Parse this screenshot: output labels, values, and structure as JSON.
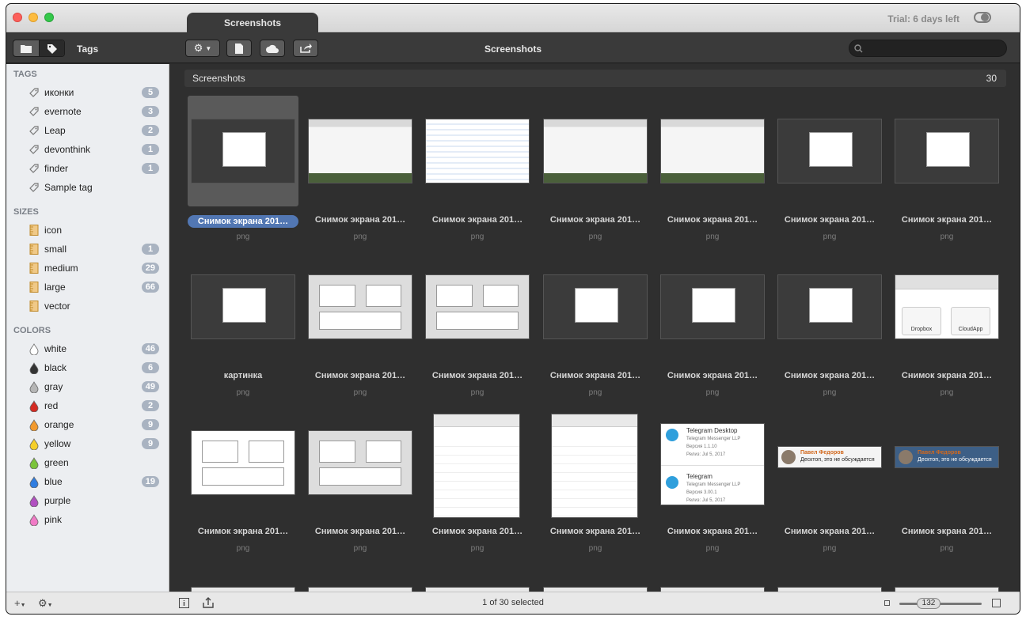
{
  "window": {
    "tab_title": "Screenshots",
    "trial": "Trial: 6 days left"
  },
  "toolbar": {
    "tags_label": "Tags",
    "title": "Screenshots",
    "search_placeholder": ""
  },
  "sidebar": {
    "tags_header": "TAGS",
    "tags": [
      {
        "label": "иконки",
        "count": "5"
      },
      {
        "label": "evernote",
        "count": "3"
      },
      {
        "label": "Leap",
        "count": "2"
      },
      {
        "label": "devonthink",
        "count": "1"
      },
      {
        "label": "finder",
        "count": "1"
      },
      {
        "label": "Sample tag",
        "count": ""
      }
    ],
    "sizes_header": "SIZES",
    "sizes": [
      {
        "label": "icon",
        "count": ""
      },
      {
        "label": "small",
        "count": "1"
      },
      {
        "label": "medium",
        "count": "29"
      },
      {
        "label": "large",
        "count": "66"
      },
      {
        "label": "vector",
        "count": ""
      }
    ],
    "colors_header": "COLORS",
    "colors": [
      {
        "label": "white",
        "count": "46",
        "hex": "#ffffff"
      },
      {
        "label": "black",
        "count": "6",
        "hex": "#333333"
      },
      {
        "label": "gray",
        "count": "49",
        "hex": "#b5b5b5"
      },
      {
        "label": "red",
        "count": "2",
        "hex": "#d42a22"
      },
      {
        "label": "orange",
        "count": "9",
        "hex": "#f29a2e"
      },
      {
        "label": "yellow",
        "count": "9",
        "hex": "#f5cf2a"
      },
      {
        "label": "green",
        "count": "",
        "hex": "#7bc43a"
      },
      {
        "label": "blue",
        "count": "19",
        "hex": "#2f7de0"
      },
      {
        "label": "purple",
        "count": "",
        "hex": "#b04fc0"
      },
      {
        "label": "pink",
        "count": "",
        "hex": "#f07ac6"
      }
    ]
  },
  "collection": {
    "title": "Screenshots",
    "count": "30"
  },
  "items": [
    {
      "caption": "Снимок экрана 201…",
      "ext": "png"
    },
    {
      "caption": "Снимок экрана 201…",
      "ext": "png"
    },
    {
      "caption": "Снимок экрана 201…",
      "ext": "png"
    },
    {
      "caption": "Снимок экрана 201…",
      "ext": "png"
    },
    {
      "caption": "Снимок экрана 201…",
      "ext": "png"
    },
    {
      "caption": "Снимок экрана 201…",
      "ext": "png"
    },
    {
      "caption": "Снимок экрана 201…",
      "ext": "png"
    },
    {
      "caption": "картинка",
      "ext": "png"
    },
    {
      "caption": "Снимок экрана 201…",
      "ext": "png"
    },
    {
      "caption": "Снимок экрана 201…",
      "ext": "png"
    },
    {
      "caption": "Снимок экрана 201…",
      "ext": "png"
    },
    {
      "caption": "Снимок экрана 201…",
      "ext": "png"
    },
    {
      "caption": "Снимок экрана 201…",
      "ext": "png"
    },
    {
      "caption": "Снимок экрана 201…",
      "ext": "png"
    },
    {
      "caption": "Снимок экрана 201…",
      "ext": "png"
    },
    {
      "caption": "Снимок экрана 201…",
      "ext": "png"
    },
    {
      "caption": "Снимок экрана 201…",
      "ext": "png"
    },
    {
      "caption": "Снимок экрана 201…",
      "ext": "png"
    },
    {
      "caption": "Снимок экрана 201…",
      "ext": "png"
    },
    {
      "caption": "Снимок экрана 201…",
      "ext": "png"
    },
    {
      "caption": "Снимок экрана 201…",
      "ext": "png"
    }
  ],
  "thumb_texts": {
    "telegram1_title": "Telegram Desktop",
    "telegram1_sub": "Telegram Messenger LLP",
    "telegram1_ver": "Версия 1.1.10",
    "telegram1_date": "Релиз: Jul 5, 2017",
    "telegram2_title": "Telegram",
    "telegram2_sub": "Telegram Messenger LLP",
    "telegram2_ver": "Версия 3.00.1",
    "telegram2_date": "Релиз: Jul 5, 2017",
    "notif_name": "Павел Федоров",
    "notif_text": "Десктоп, это не обсуждается",
    "dropbox": "Dropbox",
    "cloudapp": "CloudApp"
  },
  "statusbar": {
    "selection": "1 of 30 selected",
    "zoom": "132"
  }
}
